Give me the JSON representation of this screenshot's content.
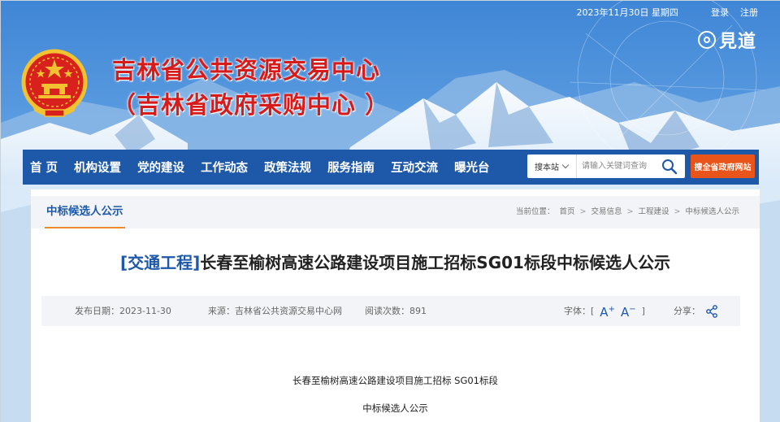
{
  "topbar": {
    "date": "2023年11月30日 星期四",
    "login": "登录",
    "register": "注册"
  },
  "watermark": {
    "text": "見道"
  },
  "header": {
    "title_line1": "吉林省公共资源交易中心",
    "title_line2": "（吉林省政府采购中心 ）"
  },
  "nav": {
    "items": [
      "首 页",
      "机构设置",
      "党的建设",
      "工作动态",
      "政策法规",
      "服务指南",
      "互动交流",
      "曝光台"
    ]
  },
  "search": {
    "scope": "搜本站",
    "placeholder": "请输入关键词查询",
    "gov_button": "搜全省政府网站"
  },
  "breadcrumb": {
    "section": "中标候选人公示",
    "prefix": "当前位置：",
    "items": [
      "首页",
      "交易信息",
      "工程建设",
      "中标候选人公示"
    ],
    "sep": ">"
  },
  "article": {
    "category": "[交通工程]",
    "title": "长春至榆树高速公路建设项目施工招标SG01标段中标候选人公示",
    "publish_date": "发布日期：2023-11-30",
    "source": "来源：吉林省公共资源交易中心网",
    "views": "阅读次数：891",
    "font_label": "字体：[",
    "font_close": "]",
    "font_up": "A",
    "font_down": "A",
    "share_label": "分享：",
    "body_line1": "长春至榆树高速公路建设项目施工招标 SG01标段",
    "body_line2": "中标候选人公示"
  },
  "colors": {
    "nav_bg": "#1e58a8",
    "title_red": "#d71b1b",
    "accent_orange": "#e8541a",
    "link_blue": "#1e58a8"
  }
}
